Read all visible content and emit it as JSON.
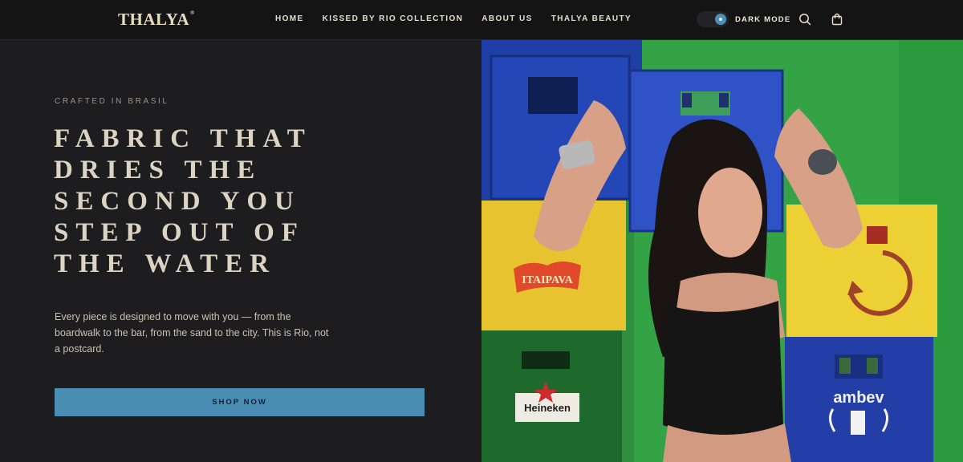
{
  "header": {
    "logo": "THALYA",
    "logo_mark": "®",
    "nav": [
      "HOME",
      "KISSED BY RIO COLLECTION",
      "ABOUT US",
      "THALYA BEAUTY"
    ],
    "dark_mode_label": "DARK MODE",
    "icons": [
      "search-icon",
      "cart-icon"
    ]
  },
  "hero": {
    "eyebrow": "CRAFTED IN BRASIL",
    "headline_lines": [
      "FABRIC THAT",
      "DRIES THE",
      "SECOND YOU",
      "STEP OUT OF",
      "THE WATER"
    ],
    "body": "Every piece is designed to move with you — from the boardwalk to the bar, from the sand to the city. This is Rio, not a postcard.",
    "cta": "SHOP NOW",
    "image": {
      "crate_labels": [
        "ITAIPAVA",
        "Heineken",
        "ambev"
      ]
    }
  },
  "colors": {
    "accent": "#4a8db3",
    "background": "#1d1d1f",
    "header_bg": "#141414"
  }
}
